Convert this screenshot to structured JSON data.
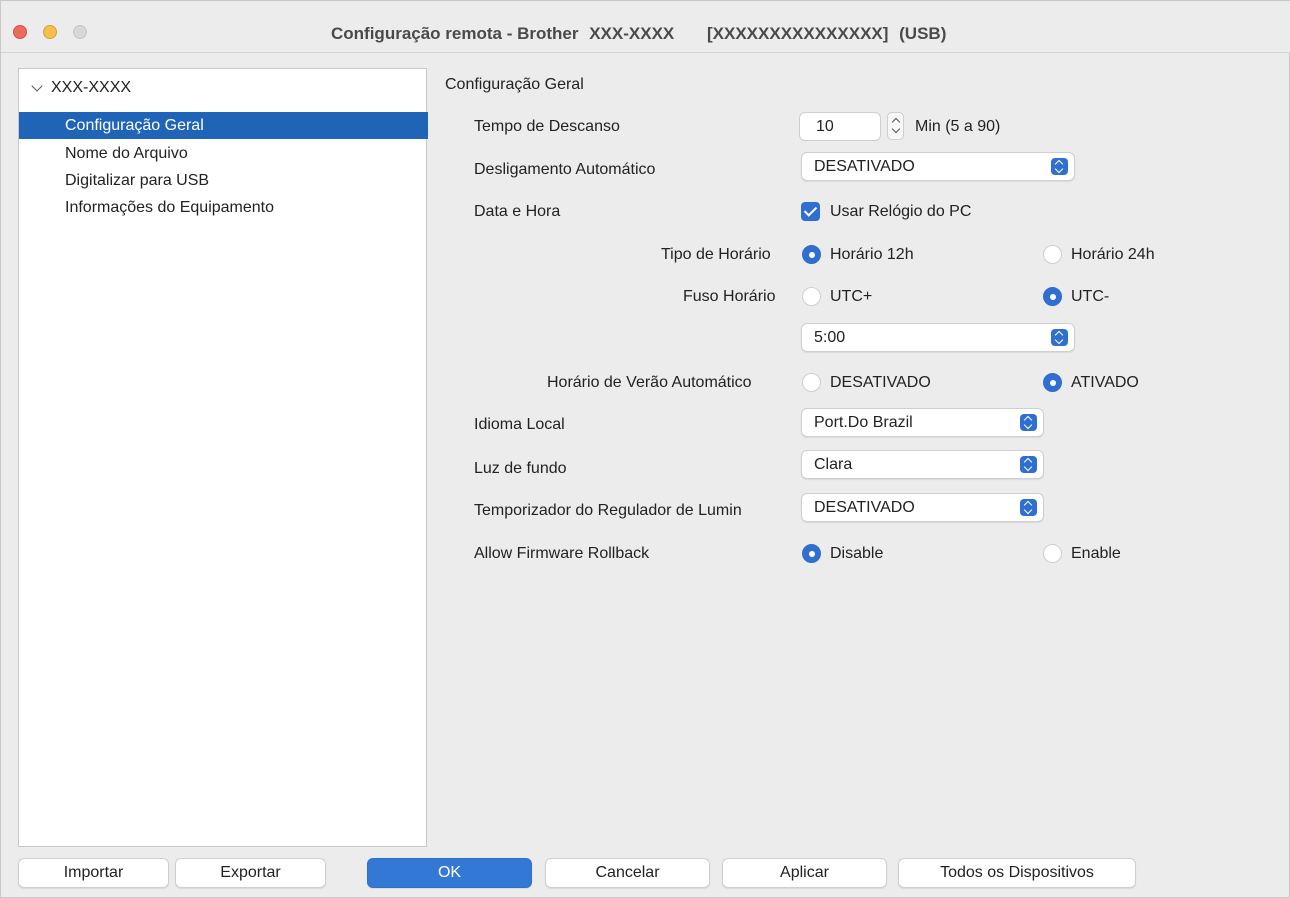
{
  "window": {
    "title": {
      "prefix": "Configuração remota - Brother",
      "model": "XXX-XXXX",
      "serial": "[XXXXXXXXXXXXXXX]",
      "connection": "(USB)"
    }
  },
  "sidebar": {
    "root": "XXX-XXXX",
    "items": [
      {
        "label": "Configuração Geral",
        "selected": true
      },
      {
        "label": "Nome do Arquivo",
        "selected": false
      },
      {
        "label": "Digitalizar para USB",
        "selected": false
      },
      {
        "label": "Informações do Equipamento",
        "selected": false
      }
    ]
  },
  "panel": {
    "title": "Configuração Geral",
    "sleep_time": {
      "label": "Tempo de Descanso",
      "value": "10",
      "unit": "Min (5 a 90)"
    },
    "auto_off": {
      "label": "Desligamento Automático",
      "value": "DESATIVADO"
    },
    "date_time": {
      "label": "Data e Hora",
      "checkbox_label": "Usar Relógio do PC",
      "checked": true
    },
    "time_type": {
      "label": "Tipo de Horário",
      "option1": "Horário 12h",
      "option2": "Horário 24h",
      "selected": "Horário 12h"
    },
    "time_zone": {
      "label": "Fuso Horário",
      "option1": "UTC+",
      "option2": "UTC-",
      "selected": "UTC-",
      "offset": "5:00"
    },
    "dst": {
      "label": "Horário de Verão Automático",
      "option1": "DESATIVADO",
      "option2": "ATIVADO",
      "selected": "ATIVADO"
    },
    "language": {
      "label": "Idioma Local",
      "value": "Port.Do Brazil"
    },
    "backlight": {
      "label": "Luz de fundo",
      "value": "Clara"
    },
    "dimmer_timer": {
      "label": "Temporizador do Regulador de Lumin",
      "value": "DESATIVADO"
    },
    "firmware_rollback": {
      "label": "Allow Firmware Rollback",
      "option1": "Disable",
      "option2": "Enable",
      "selected": "Disable"
    }
  },
  "buttons": {
    "import": "Importar",
    "export": "Exportar",
    "ok": "OK",
    "cancel": "Cancelar",
    "apply": "Aplicar",
    "all_devices": "Todos os Dispositivos"
  },
  "colors": {
    "accent": "#2f6fd0",
    "selection": "#1f64b6",
    "close": "#ec6a5e",
    "minimize": "#f4bf4f",
    "zoom_disabled": "#d8d8d8"
  }
}
